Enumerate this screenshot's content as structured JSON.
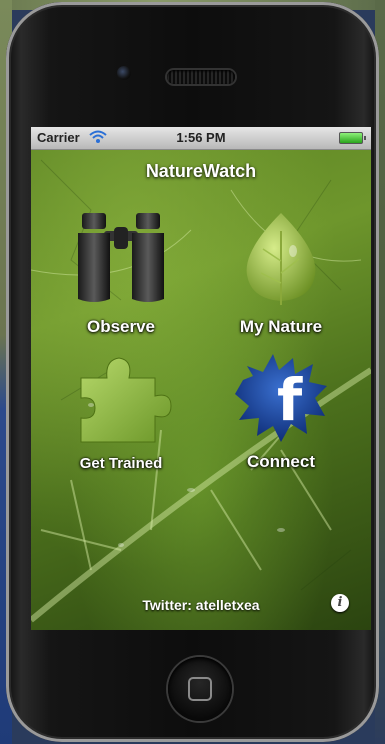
{
  "status_bar": {
    "carrier": "Carrier",
    "time": "1:56 PM"
  },
  "app": {
    "title": "NatureWatch",
    "tiles": [
      {
        "id": "observe",
        "label": "Observe",
        "icon": "binoculars-icon"
      },
      {
        "id": "my-nature",
        "label": "My Nature",
        "icon": "leaf-icon"
      },
      {
        "id": "get-trained",
        "label": "Get Trained",
        "icon": "puzzle-piece-icon"
      },
      {
        "id": "connect",
        "label": "Connect",
        "icon": "facebook-icon"
      }
    ],
    "footer": {
      "twitter": "Twitter: atelletxea",
      "info_glyph": "i"
    }
  },
  "colors": {
    "accent": "#6e962c",
    "facebook_blue": "#1f4aa0"
  }
}
